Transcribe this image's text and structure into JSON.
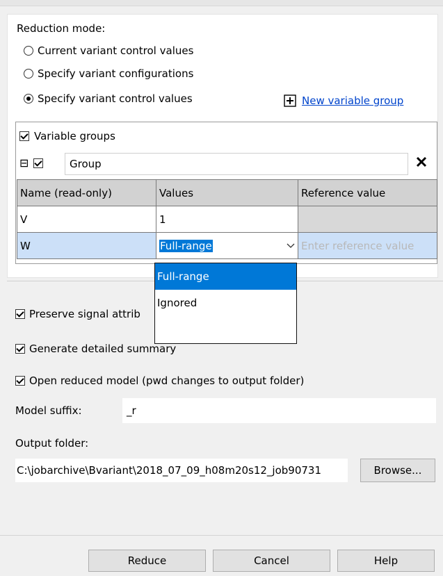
{
  "reduction_mode": {
    "label": "Reduction mode:",
    "options": [
      {
        "label": "Current variant control values",
        "checked": false
      },
      {
        "label": "Specify variant configurations",
        "checked": false
      },
      {
        "label": "Specify variant control values",
        "checked": true
      }
    ],
    "new_group_link": "New variable group"
  },
  "variable_groups": {
    "label": "Variable groups",
    "checked": true,
    "group": {
      "name": "Group",
      "checked": true,
      "expand_symbol": "⊟"
    },
    "table": {
      "headers": [
        "Name (read-only)",
        "Values",
        "Reference value"
      ],
      "rows": [
        {
          "name": "V",
          "value": "1",
          "reference": ""
        },
        {
          "name": "W",
          "value": "Full-range",
          "reference_placeholder": "Enter reference value"
        }
      ]
    },
    "dropdown_options": [
      "Full-range",
      "Ignored"
    ]
  },
  "options": {
    "preserve_signal": "Preserve signal attrib",
    "generate_summary": "Generate detailed summary",
    "open_reduced": "Open reduced model (pwd changes to output folder)"
  },
  "model_suffix": {
    "label": "Model suffix:",
    "value": "_r"
  },
  "output_folder": {
    "label": "Output folder:",
    "value": "C:\\jobarchive\\Bvariant\\2018_07_09_h08m20s12_job90731",
    "browse": "Browse..."
  },
  "buttons": {
    "reduce": "Reduce",
    "cancel": "Cancel",
    "help": "Help"
  }
}
